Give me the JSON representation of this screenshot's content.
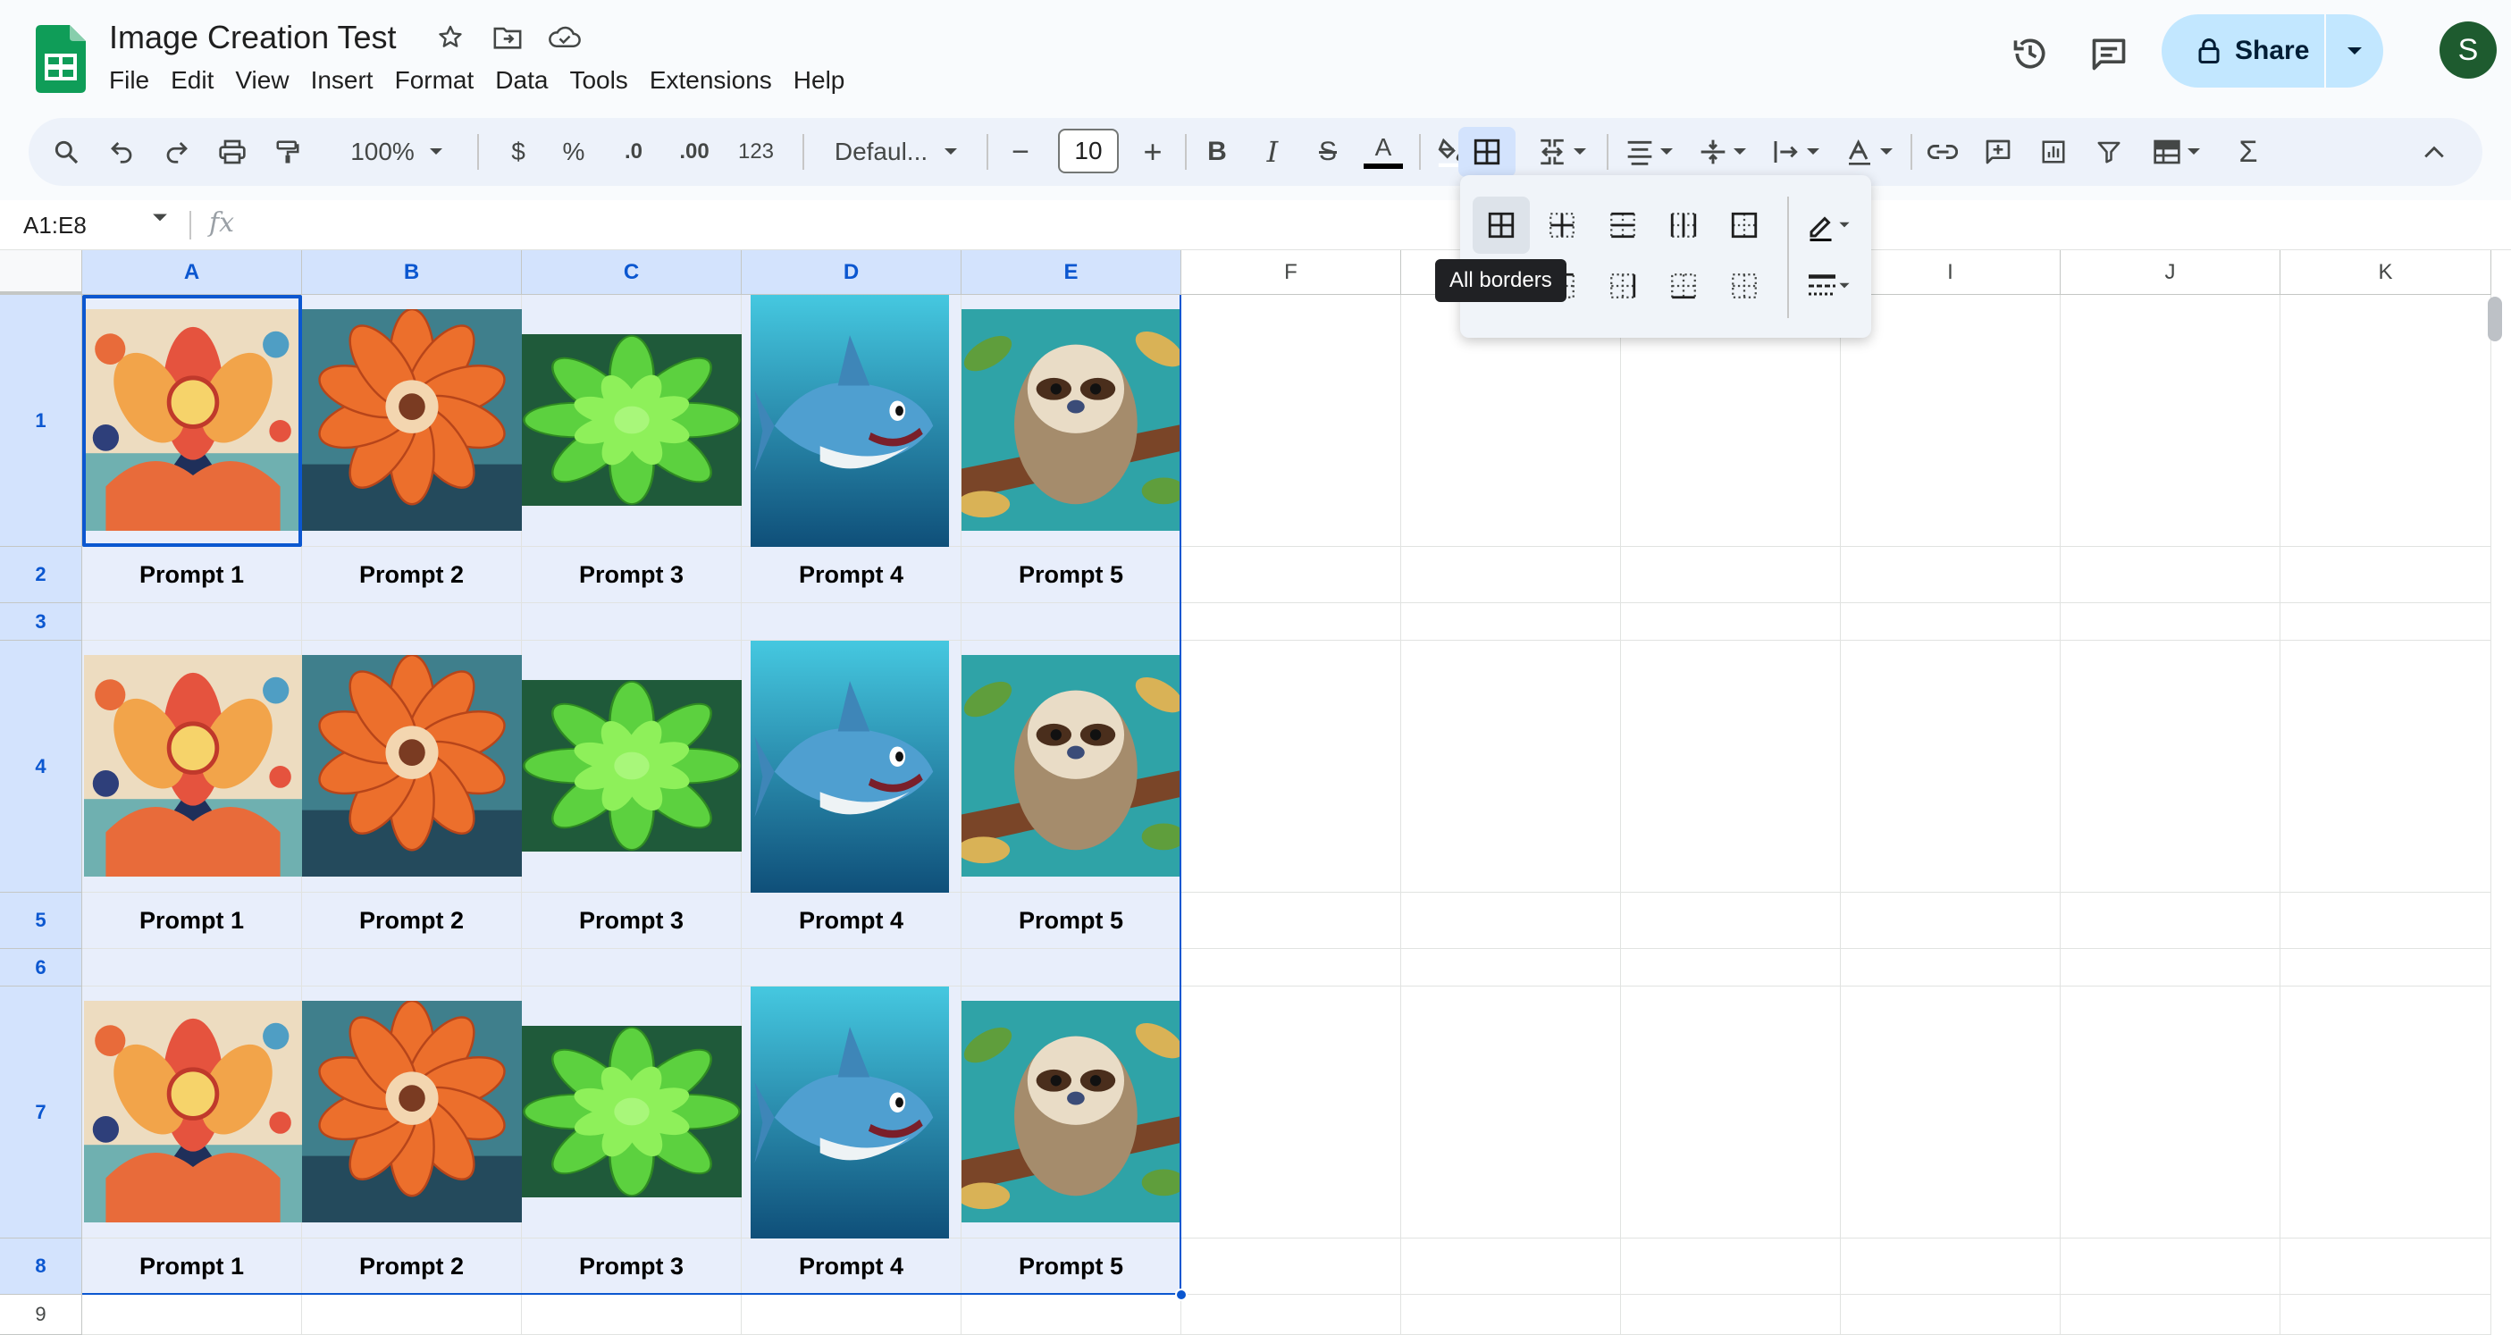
{
  "header": {
    "title": "Image Creation Test",
    "menu": [
      "File",
      "Edit",
      "View",
      "Insert",
      "Format",
      "Data",
      "Tools",
      "Extensions",
      "Help"
    ],
    "share_label": "Share",
    "avatar_initial": "S",
    "icons": {
      "star": "star-icon",
      "move": "move-to-folder-icon",
      "cloud": "cloud-saved-icon",
      "history": "version-history-icon",
      "comments": "comments-icon",
      "lock": "lock-icon"
    }
  },
  "toolbar": {
    "zoom": "100%",
    "currency": "$",
    "percent": "%",
    "decrease_decimal": ".0",
    "increase_decimal": ".00",
    "more_formats": "123",
    "font": "Defaul...",
    "font_size": "10",
    "minus": "−",
    "plus": "+",
    "bold": "B",
    "italic": "I",
    "strikethrough": "S",
    "text_color_letter": "A",
    "sum": "Σ"
  },
  "formula_bar": {
    "name_box": "A1:E8",
    "fx": "fx"
  },
  "columns": [
    "A",
    "B",
    "C",
    "D",
    "E",
    "F",
    "G",
    "H",
    "I",
    "J",
    "K"
  ],
  "rows": [
    "1",
    "2",
    "3",
    "4",
    "5",
    "6",
    "7",
    "8",
    "9"
  ],
  "labels": [
    "Prompt 1",
    "Prompt 2",
    "Prompt 3",
    "Prompt 4",
    "Prompt 5"
  ],
  "images": [
    "folk-flower-image",
    "orange-flower-image",
    "green-succulent-image",
    "cartoon-shark-image",
    "sloth-image"
  ],
  "borders_menu": {
    "tooltip": "All borders",
    "options": [
      "all-borders",
      "inner-borders",
      "horizontal-borders",
      "vertical-borders",
      "outer-borders",
      "left-border",
      "top-border",
      "right-border",
      "bottom-border",
      "clear-borders"
    ]
  },
  "colors": {
    "accent": "#0b57d0",
    "selection": "#d3e3fd",
    "share_bg": "#c2e7ff",
    "sheets_green": "#0f9d58"
  }
}
